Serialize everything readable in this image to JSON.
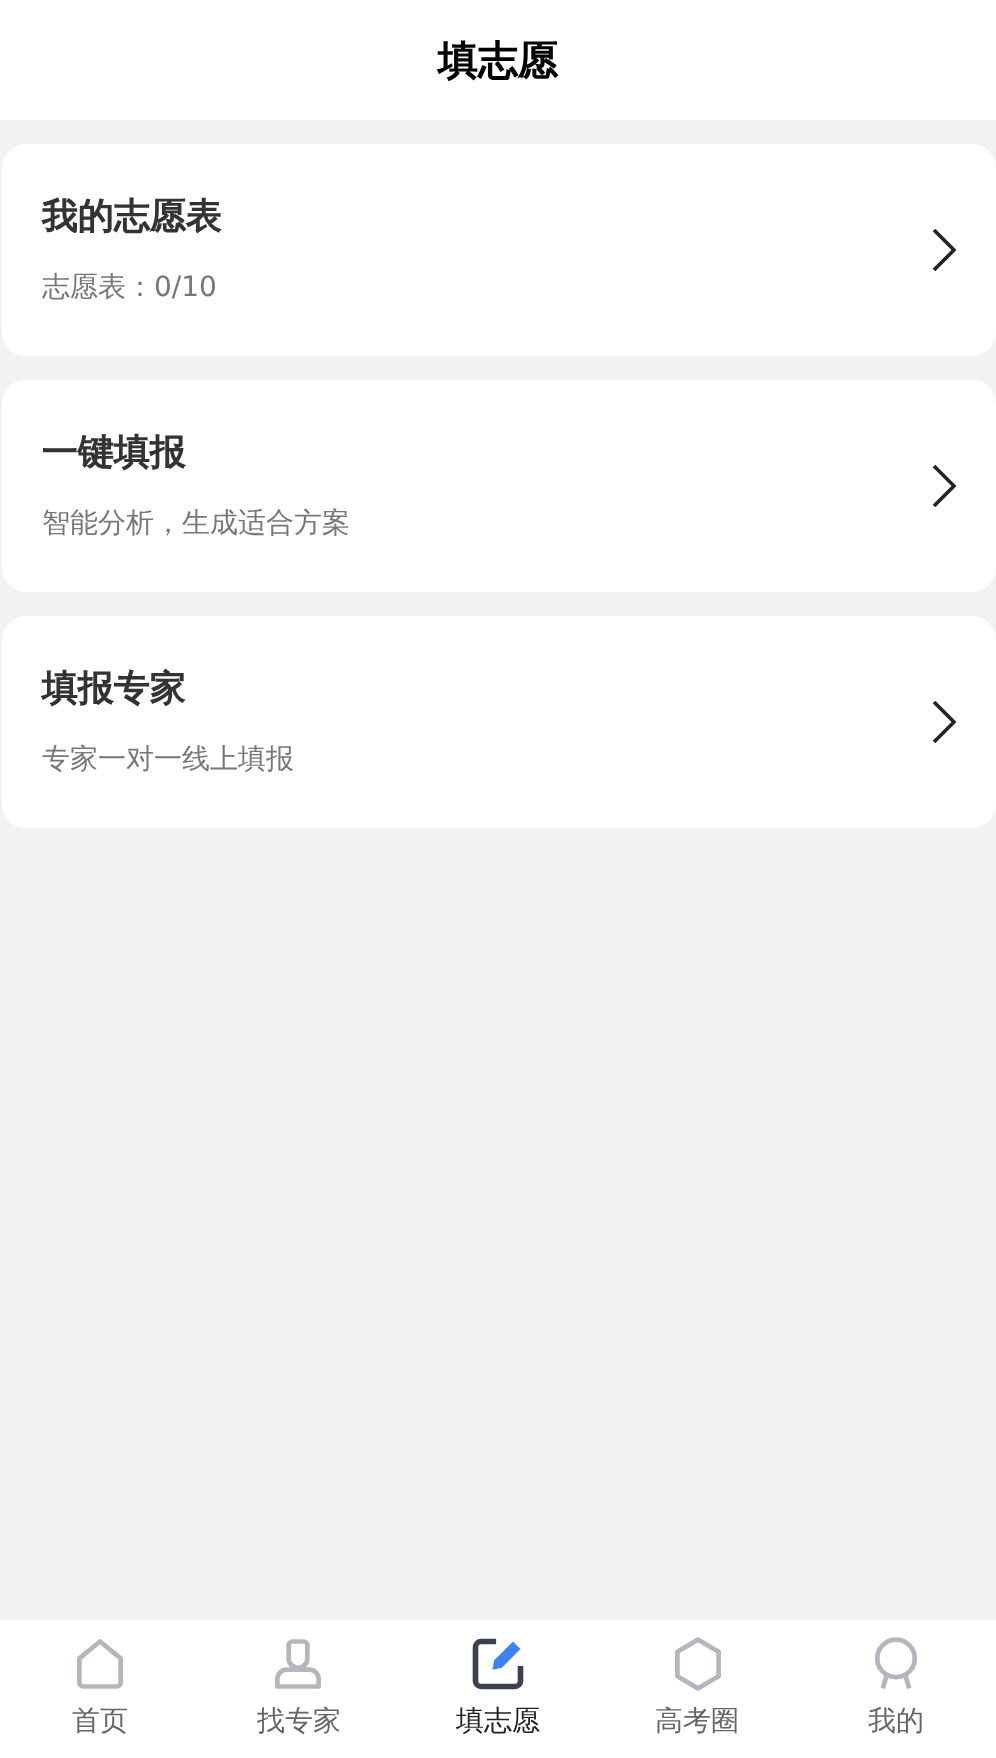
{
  "header": {
    "title": "填志愿"
  },
  "cards": [
    {
      "title": "我的志愿表",
      "subtitle": "志愿表：0/10"
    },
    {
      "title": "一键填报",
      "subtitle": "智能分析，生成适合方案"
    },
    {
      "title": "填报专家",
      "subtitle": "专家一对一线上填报"
    }
  ],
  "tab_bar": [
    {
      "label": "首页",
      "selected": false
    },
    {
      "label": "找专家",
      "selected": false
    },
    {
      "label": "填志愿",
      "selected": true
    },
    {
      "label": "高考圈",
      "selected": false
    },
    {
      "label": "我的",
      "selected": false
    }
  ]
}
